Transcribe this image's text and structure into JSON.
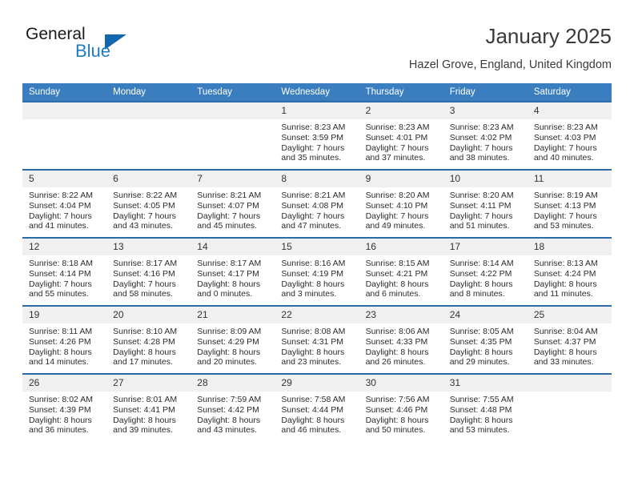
{
  "brand": {
    "name_part1": "General",
    "name_part2": "Blue",
    "accent_color": "#1567ad",
    "text_color": "#1a1a1a"
  },
  "header": {
    "title": "January 2025",
    "location": "Hazel Grove, England, United Kingdom"
  },
  "calendar": {
    "header_bg": "#3b7ebf",
    "row_border_color": "#2b6ca8",
    "daynum_bg": "#f0f0f0",
    "weekdays": [
      "Sunday",
      "Monday",
      "Tuesday",
      "Wednesday",
      "Thursday",
      "Friday",
      "Saturday"
    ],
    "weeks": [
      [
        {
          "day": "",
          "empty": true
        },
        {
          "day": "",
          "empty": true
        },
        {
          "day": "",
          "empty": true
        },
        {
          "day": "1",
          "sunrise": "Sunrise: 8:23 AM",
          "sunset": "Sunset: 3:59 PM",
          "daylight_line1": "Daylight: 7 hours",
          "daylight_line2": "and 35 minutes."
        },
        {
          "day": "2",
          "sunrise": "Sunrise: 8:23 AM",
          "sunset": "Sunset: 4:01 PM",
          "daylight_line1": "Daylight: 7 hours",
          "daylight_line2": "and 37 minutes."
        },
        {
          "day": "3",
          "sunrise": "Sunrise: 8:23 AM",
          "sunset": "Sunset: 4:02 PM",
          "daylight_line1": "Daylight: 7 hours",
          "daylight_line2": "and 38 minutes."
        },
        {
          "day": "4",
          "sunrise": "Sunrise: 8:23 AM",
          "sunset": "Sunset: 4:03 PM",
          "daylight_line1": "Daylight: 7 hours",
          "daylight_line2": "and 40 minutes."
        }
      ],
      [
        {
          "day": "5",
          "sunrise": "Sunrise: 8:22 AM",
          "sunset": "Sunset: 4:04 PM",
          "daylight_line1": "Daylight: 7 hours",
          "daylight_line2": "and 41 minutes."
        },
        {
          "day": "6",
          "sunrise": "Sunrise: 8:22 AM",
          "sunset": "Sunset: 4:05 PM",
          "daylight_line1": "Daylight: 7 hours",
          "daylight_line2": "and 43 minutes."
        },
        {
          "day": "7",
          "sunrise": "Sunrise: 8:21 AM",
          "sunset": "Sunset: 4:07 PM",
          "daylight_line1": "Daylight: 7 hours",
          "daylight_line2": "and 45 minutes."
        },
        {
          "day": "8",
          "sunrise": "Sunrise: 8:21 AM",
          "sunset": "Sunset: 4:08 PM",
          "daylight_line1": "Daylight: 7 hours",
          "daylight_line2": "and 47 minutes."
        },
        {
          "day": "9",
          "sunrise": "Sunrise: 8:20 AM",
          "sunset": "Sunset: 4:10 PM",
          "daylight_line1": "Daylight: 7 hours",
          "daylight_line2": "and 49 minutes."
        },
        {
          "day": "10",
          "sunrise": "Sunrise: 8:20 AM",
          "sunset": "Sunset: 4:11 PM",
          "daylight_line1": "Daylight: 7 hours",
          "daylight_line2": "and 51 minutes."
        },
        {
          "day": "11",
          "sunrise": "Sunrise: 8:19 AM",
          "sunset": "Sunset: 4:13 PM",
          "daylight_line1": "Daylight: 7 hours",
          "daylight_line2": "and 53 minutes."
        }
      ],
      [
        {
          "day": "12",
          "sunrise": "Sunrise: 8:18 AM",
          "sunset": "Sunset: 4:14 PM",
          "daylight_line1": "Daylight: 7 hours",
          "daylight_line2": "and 55 minutes."
        },
        {
          "day": "13",
          "sunrise": "Sunrise: 8:17 AM",
          "sunset": "Sunset: 4:16 PM",
          "daylight_line1": "Daylight: 7 hours",
          "daylight_line2": "and 58 minutes."
        },
        {
          "day": "14",
          "sunrise": "Sunrise: 8:17 AM",
          "sunset": "Sunset: 4:17 PM",
          "daylight_line1": "Daylight: 8 hours",
          "daylight_line2": "and 0 minutes."
        },
        {
          "day": "15",
          "sunrise": "Sunrise: 8:16 AM",
          "sunset": "Sunset: 4:19 PM",
          "daylight_line1": "Daylight: 8 hours",
          "daylight_line2": "and 3 minutes."
        },
        {
          "day": "16",
          "sunrise": "Sunrise: 8:15 AM",
          "sunset": "Sunset: 4:21 PM",
          "daylight_line1": "Daylight: 8 hours",
          "daylight_line2": "and 6 minutes."
        },
        {
          "day": "17",
          "sunrise": "Sunrise: 8:14 AM",
          "sunset": "Sunset: 4:22 PM",
          "daylight_line1": "Daylight: 8 hours",
          "daylight_line2": "and 8 minutes."
        },
        {
          "day": "18",
          "sunrise": "Sunrise: 8:13 AM",
          "sunset": "Sunset: 4:24 PM",
          "daylight_line1": "Daylight: 8 hours",
          "daylight_line2": "and 11 minutes."
        }
      ],
      [
        {
          "day": "19",
          "sunrise": "Sunrise: 8:11 AM",
          "sunset": "Sunset: 4:26 PM",
          "daylight_line1": "Daylight: 8 hours",
          "daylight_line2": "and 14 minutes."
        },
        {
          "day": "20",
          "sunrise": "Sunrise: 8:10 AM",
          "sunset": "Sunset: 4:28 PM",
          "daylight_line1": "Daylight: 8 hours",
          "daylight_line2": "and 17 minutes."
        },
        {
          "day": "21",
          "sunrise": "Sunrise: 8:09 AM",
          "sunset": "Sunset: 4:29 PM",
          "daylight_line1": "Daylight: 8 hours",
          "daylight_line2": "and 20 minutes."
        },
        {
          "day": "22",
          "sunrise": "Sunrise: 8:08 AM",
          "sunset": "Sunset: 4:31 PM",
          "daylight_line1": "Daylight: 8 hours",
          "daylight_line2": "and 23 minutes."
        },
        {
          "day": "23",
          "sunrise": "Sunrise: 8:06 AM",
          "sunset": "Sunset: 4:33 PM",
          "daylight_line1": "Daylight: 8 hours",
          "daylight_line2": "and 26 minutes."
        },
        {
          "day": "24",
          "sunrise": "Sunrise: 8:05 AM",
          "sunset": "Sunset: 4:35 PM",
          "daylight_line1": "Daylight: 8 hours",
          "daylight_line2": "and 29 minutes."
        },
        {
          "day": "25",
          "sunrise": "Sunrise: 8:04 AM",
          "sunset": "Sunset: 4:37 PM",
          "daylight_line1": "Daylight: 8 hours",
          "daylight_line2": "and 33 minutes."
        }
      ],
      [
        {
          "day": "26",
          "sunrise": "Sunrise: 8:02 AM",
          "sunset": "Sunset: 4:39 PM",
          "daylight_line1": "Daylight: 8 hours",
          "daylight_line2": "and 36 minutes."
        },
        {
          "day": "27",
          "sunrise": "Sunrise: 8:01 AM",
          "sunset": "Sunset: 4:41 PM",
          "daylight_line1": "Daylight: 8 hours",
          "daylight_line2": "and 39 minutes."
        },
        {
          "day": "28",
          "sunrise": "Sunrise: 7:59 AM",
          "sunset": "Sunset: 4:42 PM",
          "daylight_line1": "Daylight: 8 hours",
          "daylight_line2": "and 43 minutes."
        },
        {
          "day": "29",
          "sunrise": "Sunrise: 7:58 AM",
          "sunset": "Sunset: 4:44 PM",
          "daylight_line1": "Daylight: 8 hours",
          "daylight_line2": "and 46 minutes."
        },
        {
          "day": "30",
          "sunrise": "Sunrise: 7:56 AM",
          "sunset": "Sunset: 4:46 PM",
          "daylight_line1": "Daylight: 8 hours",
          "daylight_line2": "and 50 minutes."
        },
        {
          "day": "31",
          "sunrise": "Sunrise: 7:55 AM",
          "sunset": "Sunset: 4:48 PM",
          "daylight_line1": "Daylight: 8 hours",
          "daylight_line2": "and 53 minutes."
        },
        {
          "day": "",
          "empty": true
        }
      ]
    ]
  }
}
